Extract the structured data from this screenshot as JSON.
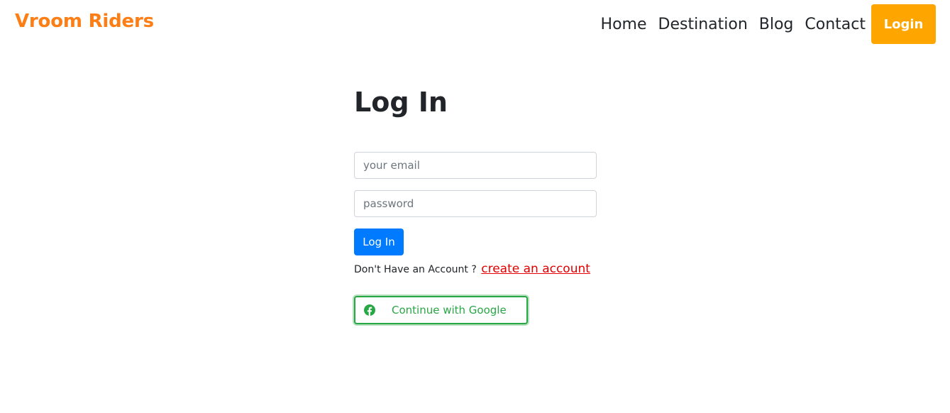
{
  "navbar": {
    "brand": "Vroom Riders",
    "links": [
      "Home",
      "Destination",
      "Blog",
      "Contact"
    ],
    "login_label": "Login"
  },
  "form": {
    "title": "Log In",
    "email_placeholder": "your email",
    "password_placeholder": "password",
    "submit_label": "Log In",
    "no_account_text": "Don't Have an Account ?",
    "create_account_label": "create an account",
    "social_label": "Continue with Google",
    "social_icon": "facebook-icon"
  },
  "colors": {
    "brand": "#fd7e14",
    "nav_login_bg": "#ffa500",
    "primary": "#007bff",
    "link": "#e00000",
    "social": "#28a745"
  }
}
